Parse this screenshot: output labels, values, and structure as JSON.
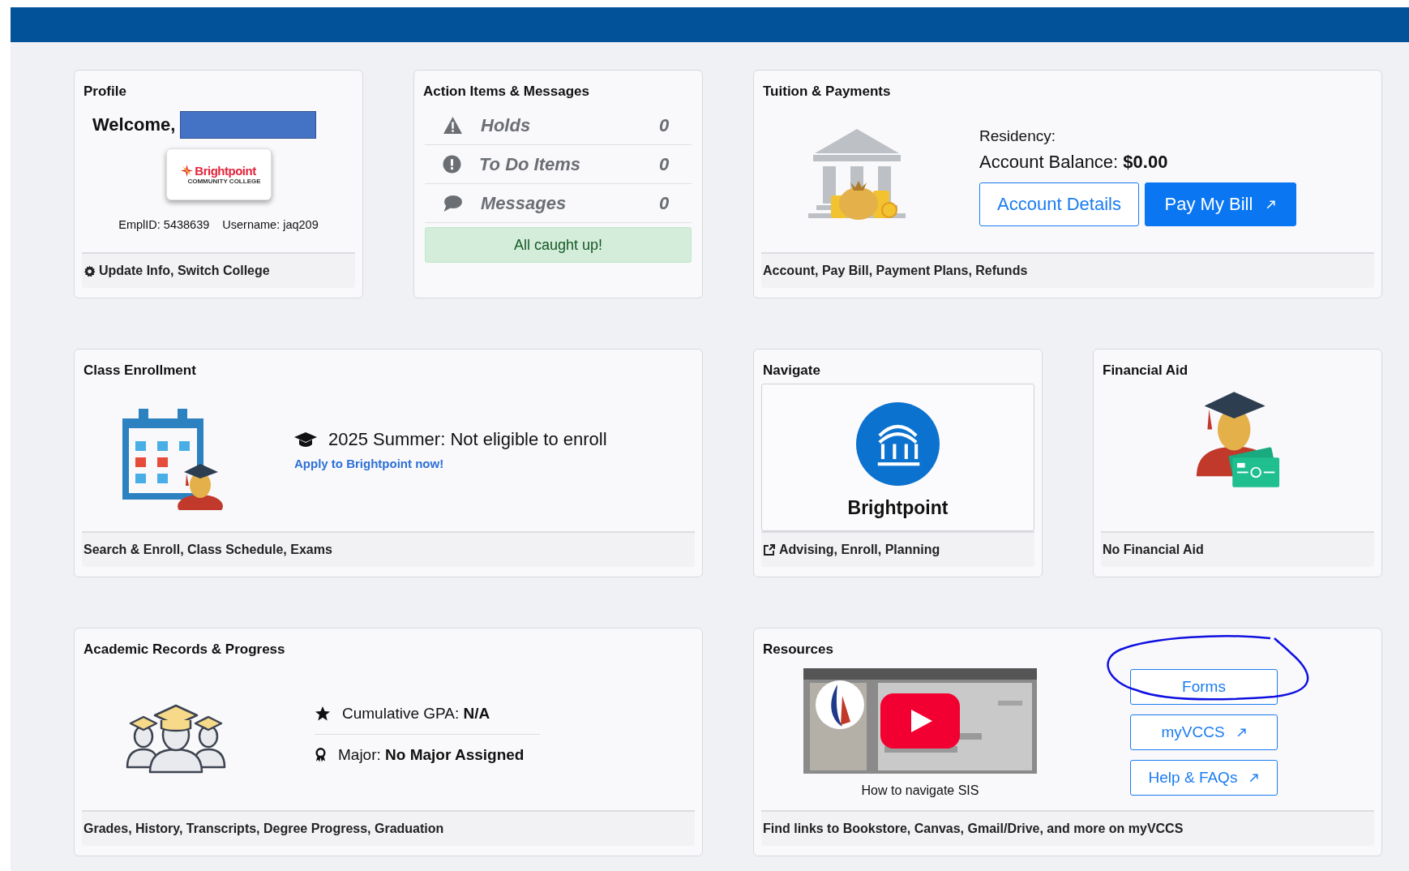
{
  "profile": {
    "title": "Profile",
    "welcome": "Welcome,",
    "logo_name": "Brightpoint",
    "logo_sub": "COMMUNITY COLLEGE",
    "emplid": "EmplID: 5438639",
    "username": "Username: jaq209",
    "footer": "Update Info, Switch College"
  },
  "action_items": {
    "title": "Action Items & Messages",
    "items": [
      {
        "kind": "warning",
        "label": "Holds",
        "count": "0"
      },
      {
        "kind": "alert",
        "label": "To Do Items",
        "count": "0"
      },
      {
        "kind": "message",
        "label": "Messages",
        "count": "0"
      }
    ],
    "status": "All caught up!"
  },
  "tuition": {
    "title": "Tuition & Payments",
    "residency": "Residency:",
    "balance": "Account Balance: **$0.00**",
    "buttons": [
      {
        "label": "Account Details",
        "kind": "outline",
        "external": false
      },
      {
        "label": "Pay My Bill",
        "kind": "primary",
        "external": true
      }
    ],
    "footer": "Account, Pay Bill, Payment Plans, Refunds"
  },
  "class_enrollment": {
    "title": "Class Enrollment",
    "term_status": "2025 Summer: Not eligible to enroll",
    "link": "Apply to Brightpoint now!",
    "footer": "Search & Enroll, Class Schedule, Exams"
  },
  "navigate": {
    "title": "Navigate",
    "brand": "Brightpoint",
    "footer": "Advising, Enroll, Planning"
  },
  "financial_aid": {
    "title": "Financial Aid",
    "footer": "No Financial Aid"
  },
  "academic_records": {
    "title": "Academic Records & Progress",
    "facts": [
      {
        "kind": "gpa",
        "text": "Cumulative GPA: **N/A**"
      },
      {
        "kind": "major",
        "text": "Major: **No Major Assigned**"
      }
    ],
    "footer": "Grades, History, Transcripts, Degree Progress, Graduation"
  },
  "resources": {
    "title": "Resources",
    "video": {
      "kind": "picture",
      "caption": "How to navigate SIS"
    },
    "links": [
      {
        "label": "Forms",
        "external": false
      },
      {
        "label": "myVCCS",
        "external": true
      },
      {
        "label": "Help & FAQs",
        "external": true
      }
    ],
    "footer": "Find links to Bookstore, Canvas, Gmail/Drive, and more on myVCCS"
  }
}
